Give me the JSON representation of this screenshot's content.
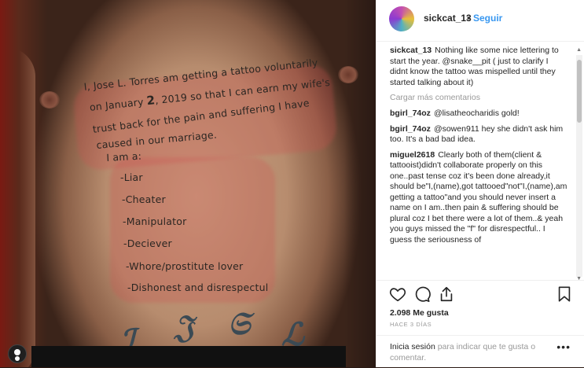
{
  "post": {
    "username": "sickcat_13",
    "separator": "•",
    "follow_label": "Seguir"
  },
  "tattoo": {
    "line1": "I, Jose L. Torres  am getting a tattoo voluntarily",
    "line2a": "on January ",
    "line2b": "2",
    "line2c": ", 2019 so that I can earn my wife's",
    "line3": "trust back for the pain and suffering I have",
    "line4": "caused in our marriage.",
    "line5": "I am a:",
    "items": [
      "-Liar",
      "-Cheater",
      "-Manipulator",
      "-Deciever",
      "-Whore/prostitute lover",
      "-Dishonest and disrespectul"
    ]
  },
  "comments": {
    "caption_user": "sickcat_13",
    "caption_text": "Nothing like some nice lettering to start the year. @snake__pit ( just to clarify I didnt know the tattoo was mispelled until they started talking about it)",
    "load_more": "Cargar más comentarios",
    "items": [
      {
        "user": "bgirl_74oz",
        "text": "@lisatheocharidis gold!"
      },
      {
        "user": "bgirl_74oz",
        "text": "@sowen911 hey she didn't ask him too. It's a bad bad idea."
      },
      {
        "user": "miguel2618",
        "text": "Clearly both of them(client & tattooist)didn't collaborate properly on this one..past tense coz it's been done already,it should be\"I,(name),got tattooed\"not\"I,(name),am getting a tattoo\"and you should never insert a name on I am..then pain & suffering should be plural coz I bet there were a lot of them..& yeah you guys missed the \"f\" for disrespectful.. I guess the seriousness of"
      }
    ]
  },
  "stats": {
    "likes": "2.098 Me gusta",
    "time": "HACE 3 DÍAS"
  },
  "login": {
    "link": "Inicia sesión",
    "rest": " para indicar que te gusta o comentar.",
    "more": "•••"
  },
  "colors": {
    "accent": "#3897f0",
    "text": "#262626",
    "muted": "#999999"
  },
  "icons": [
    "heart-icon",
    "comment-icon",
    "share-icon",
    "bookmark-icon",
    "avatar-icon"
  ]
}
